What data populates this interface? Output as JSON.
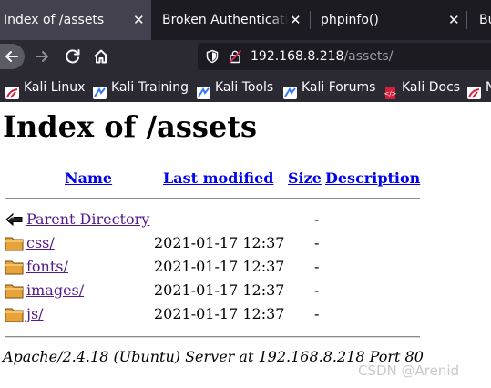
{
  "browser": {
    "tabs": [
      {
        "title": "Index of /assets",
        "close": "✕"
      },
      {
        "title": "Broken Authentication",
        "close": "✕"
      },
      {
        "title": "phpinfo()",
        "close": "✕"
      },
      {
        "title": "Bu"
      }
    ],
    "url": {
      "host": "192.168.8.218",
      "path": "/assets/"
    },
    "bookmarks": [
      {
        "label": "Kali Linux",
        "icon": "kali-dragon-icon"
      },
      {
        "label": "Kali Training",
        "icon": "kali-training-icon"
      },
      {
        "label": "Kali Tools",
        "icon": "kali-tools-icon"
      },
      {
        "label": "Kali Forums",
        "icon": "kali-forums-icon"
      },
      {
        "label": "Kali Docs",
        "icon": "kali-docs-icon"
      },
      {
        "label": "N",
        "icon": "kali-dragon-icon"
      }
    ]
  },
  "listing": {
    "title": "Index of /assets",
    "columns": {
      "name": "Name",
      "modified": "Last modified",
      "size": "Size",
      "description": "Description"
    },
    "rows": [
      {
        "name": "Parent Directory",
        "modified": "",
        "size": "-",
        "icon": "back-arrow-icon"
      },
      {
        "name": "css/",
        "modified": "2021-01-17 12:37",
        "size": "-",
        "icon": "folder-icon"
      },
      {
        "name": "fonts/",
        "modified": "2021-01-17 12:37",
        "size": "-",
        "icon": "folder-icon"
      },
      {
        "name": "images/",
        "modified": "2021-01-17 12:37",
        "size": "-",
        "icon": "folder-icon"
      },
      {
        "name": "js/",
        "modified": "2021-01-17 12:37",
        "size": "-",
        "icon": "folder-icon"
      }
    ],
    "server_signature": "Apache/2.4.18 (Ubuntu) Server at 192.168.8.218 Port 80"
  },
  "watermark": "CSDN @Arenid",
  "colors": {
    "link": "#0000ee",
    "visited": "#551a8b",
    "chrome_bg": "#2b2a33",
    "tabstrip_bg": "#1c1b22",
    "active_tab": "#42414d"
  }
}
